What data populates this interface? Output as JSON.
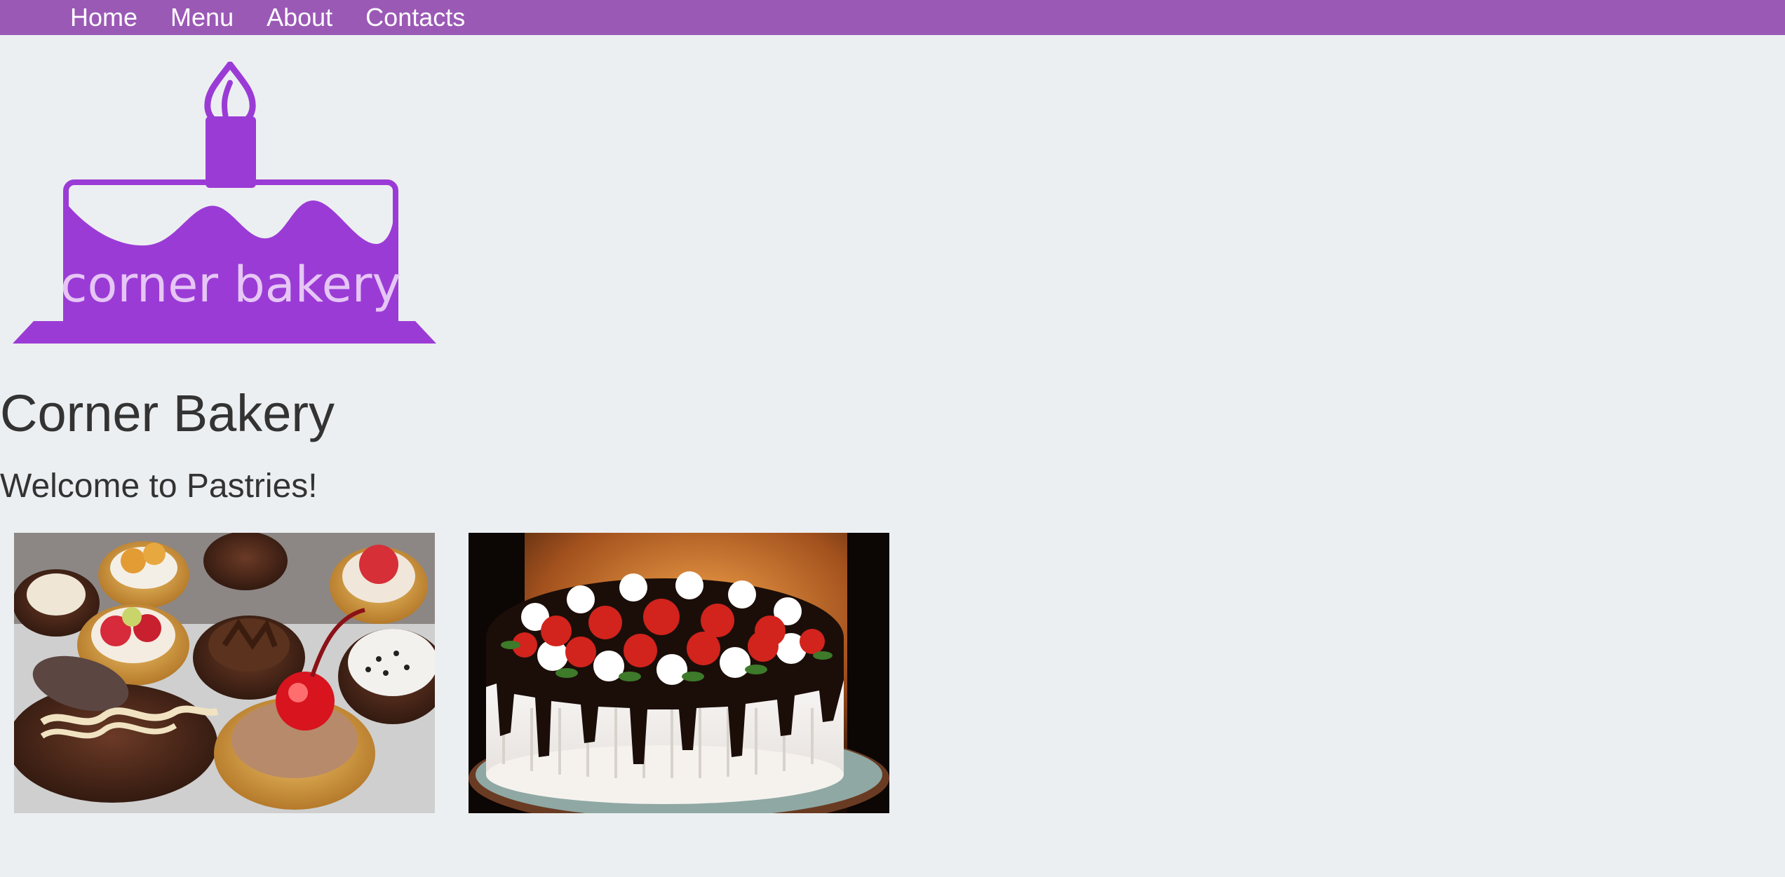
{
  "nav": {
    "items": [
      {
        "label": "Home"
      },
      {
        "label": "Menu"
      },
      {
        "label": "About"
      },
      {
        "label": "Contacts"
      }
    ]
  },
  "logo": {
    "text": "corner bakery",
    "color": "#9b3bd6",
    "icon": "cake-with-candle-logo"
  },
  "page": {
    "title": "Corner Bakery",
    "welcome": "Welcome to Pastries!"
  },
  "gallery": {
    "images": [
      {
        "icon": "pastries-tarts-photo"
      },
      {
        "icon": "strawberry-chocolate-cake-photo"
      }
    ]
  },
  "colors": {
    "navbar": "#9b59b6",
    "background": "#eceff1",
    "text": "#333333"
  }
}
